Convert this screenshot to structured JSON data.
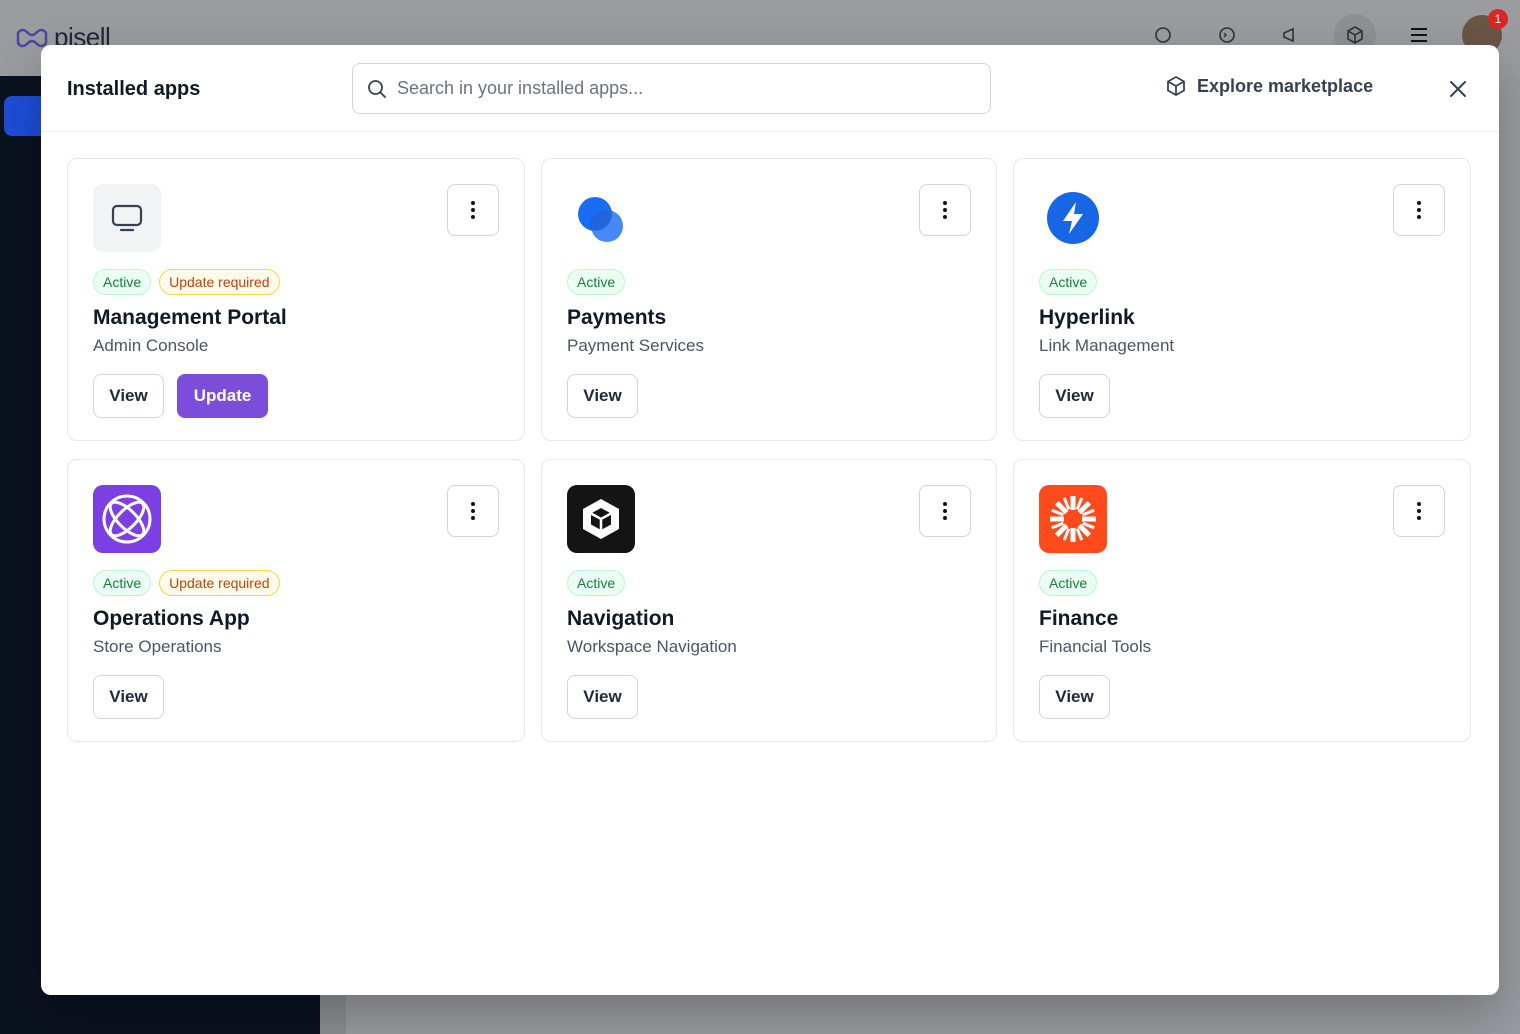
{
  "background": {
    "logo_text": "pisell",
    "notification_count": "1"
  },
  "modal": {
    "title": "Installed apps",
    "search": {
      "placeholder": "Search in your installed apps...",
      "value": ""
    },
    "explore_label": "Explore marketplace"
  },
  "apps": [
    {
      "name": "Management Portal",
      "subtitle": "Admin Console",
      "status": "Active",
      "update_badge": "Update required",
      "view_label": "View",
      "update_label": "Update"
    },
    {
      "name": "Payments",
      "subtitle": "Payment Services",
      "status": "Active",
      "view_label": "View"
    },
    {
      "name": "Hyperlink",
      "subtitle": "Link Management",
      "status": "Active",
      "view_label": "View"
    },
    {
      "name": "Operations App",
      "subtitle": "Store Operations",
      "status": "Active",
      "update_badge": "Update required",
      "view_label": "View"
    },
    {
      "name": "Navigation",
      "subtitle": "Workspace Navigation",
      "status": "Active",
      "view_label": "View"
    },
    {
      "name": "Finance",
      "subtitle": "Financial Tools",
      "status": "Active",
      "view_label": "View"
    }
  ],
  "colors": {
    "accent": "#7c4ddb",
    "active_text": "#15803d",
    "warn_text": "#c2410c",
    "payments_blue": "#1a6cf5",
    "hyperlink_blue": "#1766e6",
    "operations_purple": "#7b3fe4",
    "navigation_black": "#141414",
    "finance_orange": "#ff4a1c"
  }
}
